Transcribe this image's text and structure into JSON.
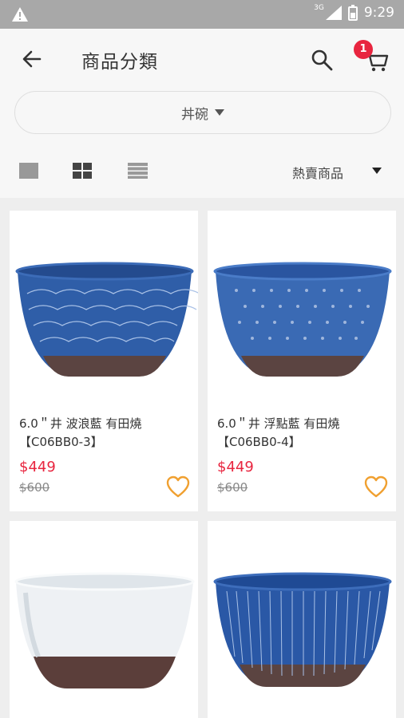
{
  "status_bar": {
    "network": "3G",
    "time": "9:29"
  },
  "header": {
    "title": "商品分類",
    "cart_count": "1"
  },
  "category": {
    "selected": "丼碗"
  },
  "sort": {
    "selected": "熱賣商品"
  },
  "colors": {
    "accent": "#e8253f",
    "favorite": "#f0a030",
    "bowl_blue": "#2f5ea8",
    "clay": "#5b4441"
  },
  "products": [
    {
      "name": "6.0＂井 波浪藍 有田燒",
      "code": "【C06BB0-3】",
      "price": "$449",
      "original_price": "$600"
    },
    {
      "name": "6.0＂井 浮點藍 有田燒",
      "code": "【C06BB0-4】",
      "price": "$449",
      "original_price": "$600"
    },
    {
      "name": "",
      "code": "",
      "price": "",
      "original_price": ""
    },
    {
      "name": "",
      "code": "",
      "price": "",
      "original_price": ""
    }
  ]
}
